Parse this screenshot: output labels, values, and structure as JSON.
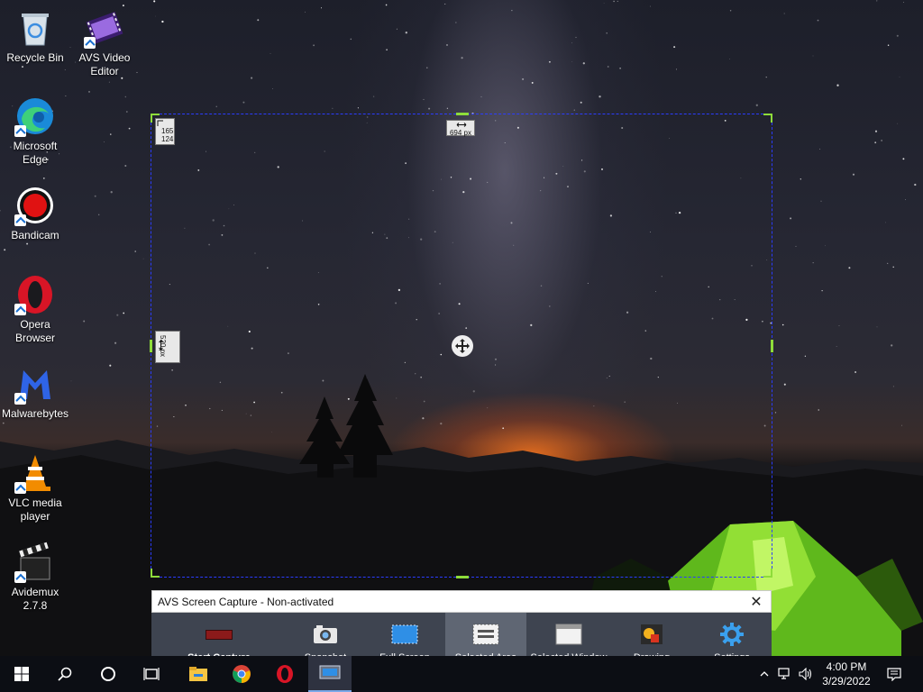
{
  "desktop": {
    "icons": [
      {
        "label": "Recycle Bin",
        "icon": "recycle-bin-icon"
      },
      {
        "label": "AVS Video Editor",
        "icon": "film-icon"
      },
      {
        "label": "Microsoft Edge",
        "icon": "edge-icon"
      },
      {
        "label": "Bandicam",
        "icon": "bandicam-icon"
      },
      {
        "label": "Opera Browser",
        "icon": "opera-icon"
      },
      {
        "label": "Malwarebytes",
        "icon": "malwarebytes-icon"
      },
      {
        "label": "VLC media player",
        "icon": "vlc-icon"
      },
      {
        "label": "Avidemux 2.7.8",
        "icon": "clapperboard-icon"
      }
    ]
  },
  "selection": {
    "x": "165",
    "y": "124",
    "width": "694 px",
    "height": "520 px"
  },
  "capture_window": {
    "title": "AVS Screen Capture - Non-activated",
    "close_label": "✕",
    "tools": [
      {
        "label": "Start Capture",
        "icon": "record-icon"
      },
      {
        "label": "Snapshot",
        "icon": "camera-icon"
      },
      {
        "label": "Full Screen",
        "icon": "full-screen-icon"
      },
      {
        "label": "Selected Area",
        "icon": "selected-area-icon",
        "active": true
      },
      {
        "label": "Selected Window",
        "icon": "window-icon"
      },
      {
        "label": "Drawing",
        "icon": "drawing-icon"
      },
      {
        "label": "Settings",
        "icon": "gear-icon"
      }
    ]
  },
  "taskbar": {
    "time": "4:00 PM",
    "date": "3/29/2022",
    "items": [
      "windows-start-icon",
      "search-icon",
      "cortana-icon",
      "task-view-icon",
      "file-explorer-icon",
      "chrome-icon",
      "opera-icon",
      "avs-capture-icon"
    ],
    "tray": [
      "chevron-up-icon",
      "network-icon",
      "volume-icon",
      "notification-icon"
    ]
  },
  "colors": {
    "selection_border": "#2b3cff",
    "handle": "#8edc3a",
    "toolbar_bg": "#3e4450",
    "toolbar_active": "#5f6673",
    "taskbar_bg": "#0c0e14"
  }
}
